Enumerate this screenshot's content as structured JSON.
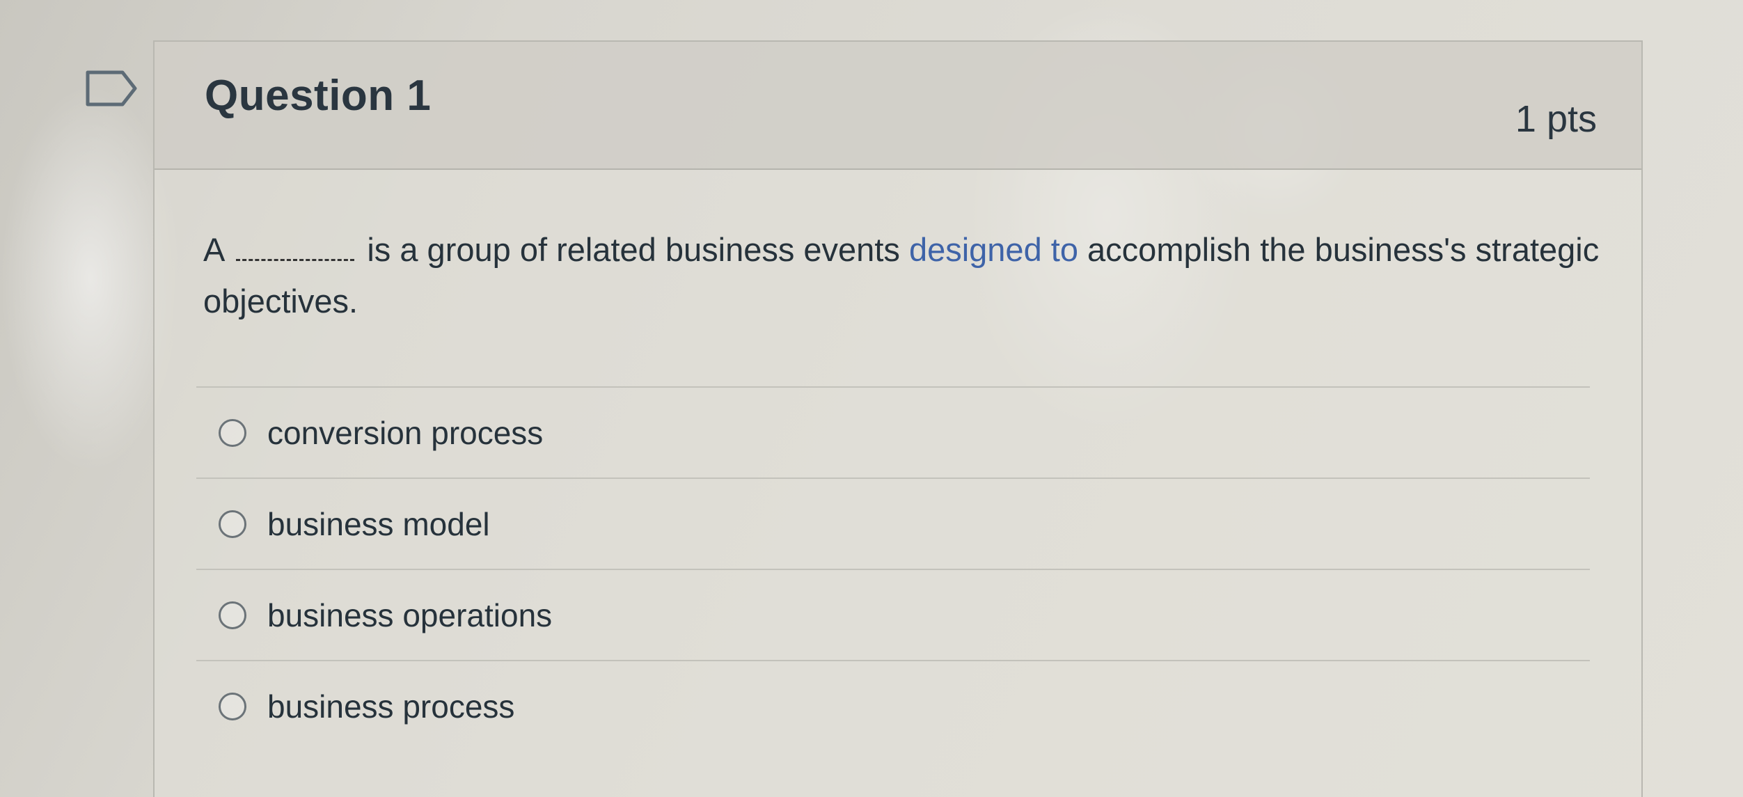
{
  "question": {
    "title": "Question 1",
    "points": "1 pts",
    "text_start": "A",
    "text_middle": "is a group of related business events ",
    "text_accent": "designed to",
    "text_end": " accomplish the business's strategic objectives."
  },
  "answers": [
    {
      "label": "conversion process"
    },
    {
      "label": "business model"
    },
    {
      "label": "business operations"
    },
    {
      "label": "business process"
    }
  ],
  "icons": {
    "flag": "bookmark-flag-icon",
    "radio": "radio-unchecked"
  },
  "colors": {
    "accent_text": "#3e63a8",
    "header_bg": "#cdcbc4",
    "text": "#26323b"
  }
}
